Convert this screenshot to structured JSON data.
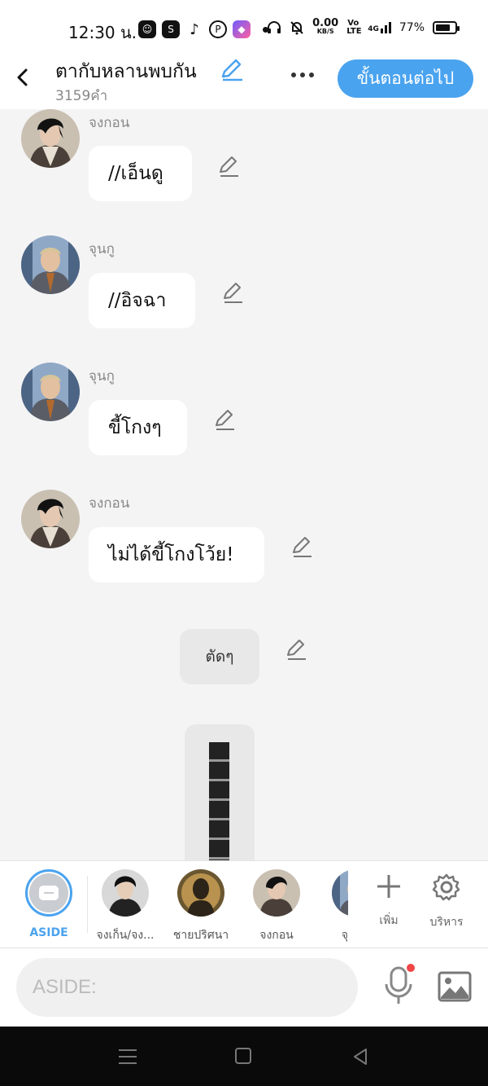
{
  "status_bar": {
    "time": "12:30 น.",
    "data_speed_value": "0.00",
    "data_speed_unit": "KB/S",
    "volte_label": "Vo LTE",
    "network": "4G",
    "battery": "77%",
    "battery_level": 0.77,
    "app_icons": [
      "line-icon",
      "shopee-icon",
      "tiktok-icon",
      "pinterest-icon",
      "messenger-icon"
    ]
  },
  "header": {
    "title": "ตากับหลานพบกัน",
    "word_count": "3159คำ",
    "next_button": "ขั้นตอนต่อไป"
  },
  "messages": [
    {
      "speaker": "จงกอน",
      "text": "//เอ็นดู"
    },
    {
      "speaker": "จุนกู",
      "text": "//อิจฉา"
    },
    {
      "speaker": "จุนกู",
      "text": "ขี้โกงๆ"
    },
    {
      "speaker": "จงกอน",
      "text": "ไม่ได้ขี้โกงโว้ย!"
    }
  ],
  "narration": "ตัดๆ",
  "characters": [
    {
      "label": "ASIDE"
    },
    {
      "label": "จงเก็น/จง..."
    },
    {
      "label": "ชายปริศนา"
    },
    {
      "label": "จงกอน"
    },
    {
      "label": "จุ"
    }
  ],
  "tools": {
    "add": "เพิ่ม",
    "manage": "บริหาร"
  },
  "input": {
    "placeholder": "ASIDE:"
  },
  "colors": {
    "accent": "#4aa3ef",
    "bubble": "#ffffff",
    "background": "#f4f4f4",
    "narration": "#e8e8e8"
  }
}
